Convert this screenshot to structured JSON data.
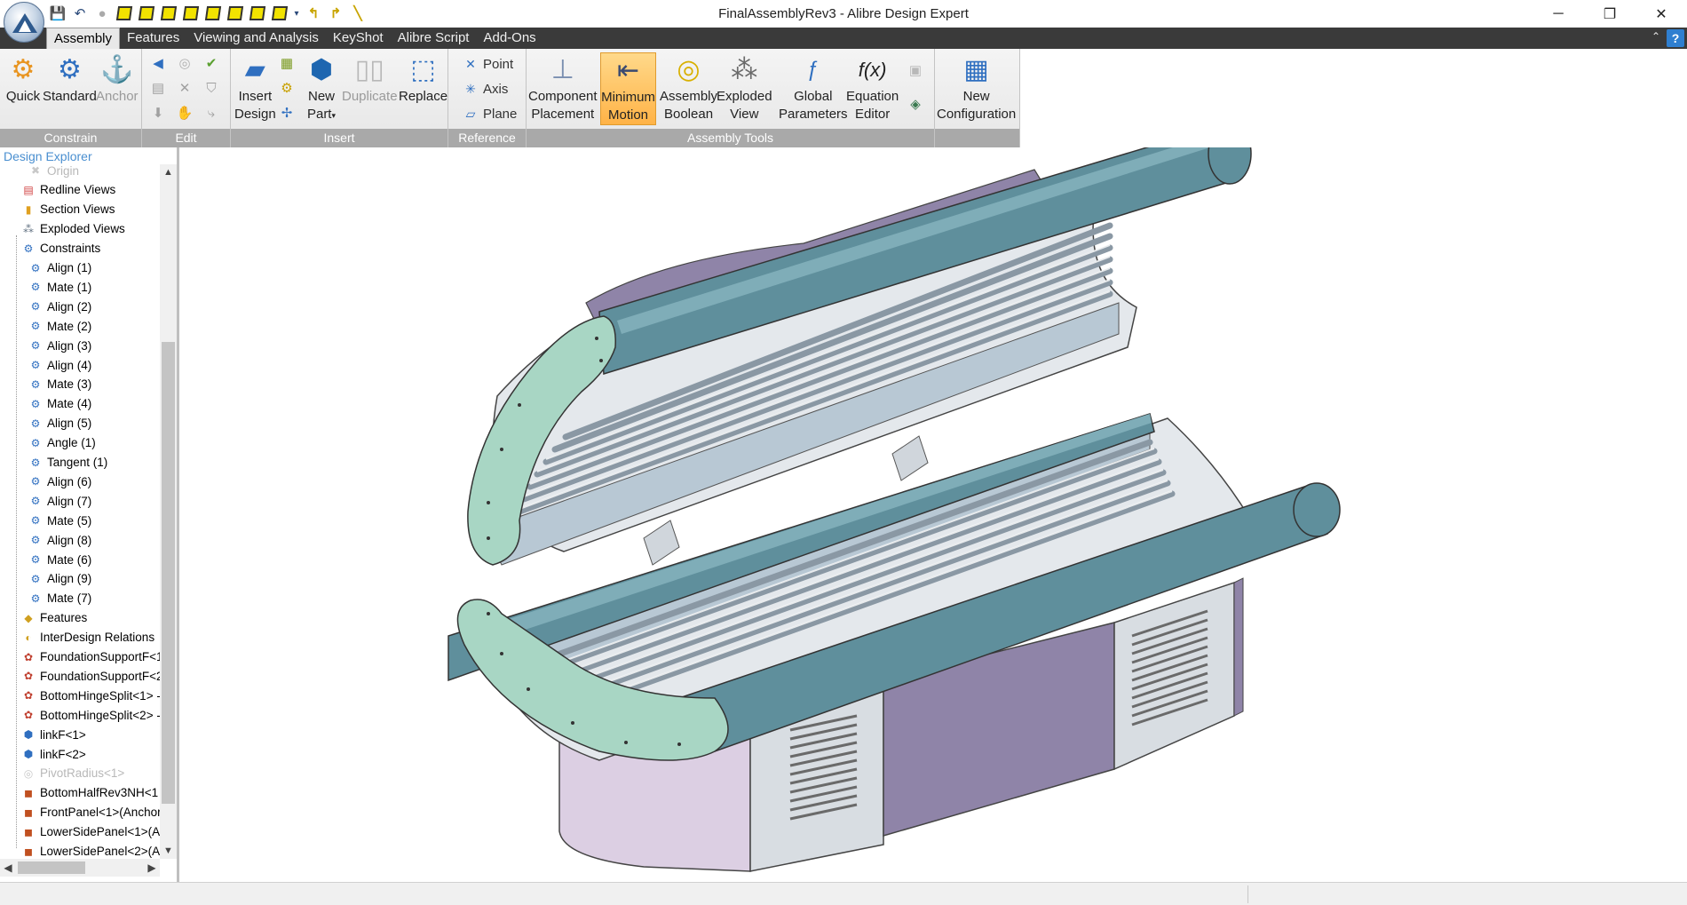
{
  "window": {
    "title": "FinalAssemblyRev3 - Alibre Design Expert",
    "controls": {
      "minimize": "─",
      "restore": "❐",
      "close": "✕"
    }
  },
  "quick_access": {
    "icons": [
      "save-icon",
      "undo-icon",
      "redo-icon",
      "box-view-icon",
      "front-view-icon",
      "back-view-icon",
      "left-view-icon",
      "right-view-icon",
      "top-view-icon",
      "bottom-view-icon",
      "iso-view-icon",
      "dropdown-icon",
      "rotate-left-icon",
      "rotate-right-icon",
      "sketch-line-icon"
    ]
  },
  "menu": {
    "tabs": [
      {
        "label": "Assembly",
        "active": true
      },
      {
        "label": "Features",
        "active": false
      },
      {
        "label": "Viewing and Analysis",
        "active": false
      },
      {
        "label": "KeyShot",
        "active": false
      },
      {
        "label": "Alibre Script",
        "active": false
      },
      {
        "label": "Add-Ons",
        "active": false
      }
    ],
    "collapse_glyph": "⌃",
    "help_glyph": "?"
  },
  "ribbon": {
    "constrain": {
      "label": "Constrain",
      "buttons": [
        {
          "label": "Quick",
          "icon": "quick-constraint-icon",
          "disabled": false
        },
        {
          "label": "Standard",
          "icon": "standard-constraint-icon",
          "disabled": false
        },
        {
          "label": "Anchor",
          "icon": "anchor-icon",
          "disabled": true
        }
      ]
    },
    "edit": {
      "label": "Edit"
    },
    "insert": {
      "label": "Insert",
      "buttons": [
        {
          "label1": "Insert",
          "label2": "Design",
          "icon": "insert-design-icon"
        },
        {
          "label1": "New",
          "label2": "Part",
          "icon": "new-part-icon"
        },
        {
          "label1": "Duplicate",
          "label2": "",
          "icon": "duplicate-icon",
          "disabled": true
        },
        {
          "label1": "Replace",
          "label2": "",
          "icon": "replace-icon"
        }
      ]
    },
    "reference": {
      "label": "Reference",
      "buttons": [
        {
          "label": "Point",
          "icon": "point-icon"
        },
        {
          "label": "Axis",
          "icon": "axis-icon"
        },
        {
          "label": "Plane",
          "icon": "plane-icon"
        }
      ]
    },
    "assembly_tools": {
      "label": "Assembly Tools",
      "buttons": [
        {
          "label1": "Component",
          "label2": "Placement",
          "icon": "component-placement-icon"
        },
        {
          "label1": "Minimum",
          "label2": "Motion",
          "icon": "minimum-motion-icon",
          "highlighted": true
        },
        {
          "label1": "Assembly",
          "label2": "Boolean",
          "icon": "assembly-boolean-icon"
        },
        {
          "label1": "Exploded",
          "label2": "View",
          "icon": "exploded-view-icon"
        },
        {
          "label1": "Global",
          "label2": "Parameters",
          "icon": "global-parameters-icon"
        },
        {
          "label1": "Equation",
          "label2": "Editor",
          "icon": "equation-editor-icon"
        }
      ]
    },
    "configuration": {
      "label1": "New",
      "label2": "Configuration",
      "icon": "new-configuration-icon"
    }
  },
  "explorer": {
    "title": "Design Explorer",
    "items": [
      {
        "label": "Origin",
        "icon": "origin-icon",
        "dim": true,
        "indent": 2
      },
      {
        "label": "Redline Views",
        "icon": "redline-views-icon",
        "indent": 1
      },
      {
        "label": "Section Views",
        "icon": "section-views-icon",
        "indent": 1
      },
      {
        "label": "Exploded Views",
        "icon": "exploded-views-icon",
        "indent": 1
      },
      {
        "label": "Constraints",
        "icon": "constraints-icon",
        "indent": 1
      },
      {
        "label": "Align (1)",
        "icon": "constraint-icon",
        "indent": 2
      },
      {
        "label": "Mate (1)",
        "icon": "constraint-icon",
        "indent": 2
      },
      {
        "label": "Align (2)",
        "icon": "constraint-icon",
        "indent": 2
      },
      {
        "label": "Mate (2)",
        "icon": "constraint-icon",
        "indent": 2
      },
      {
        "label": "Align (3)",
        "icon": "constraint-icon",
        "indent": 2
      },
      {
        "label": "Align (4)",
        "icon": "constraint-icon",
        "indent": 2
      },
      {
        "label": "Mate (3)",
        "icon": "constraint-icon",
        "indent": 2
      },
      {
        "label": "Mate (4)",
        "icon": "constraint-icon",
        "indent": 2
      },
      {
        "label": "Align (5)",
        "icon": "constraint-icon",
        "indent": 2
      },
      {
        "label": "Angle (1)",
        "icon": "constraint-icon",
        "indent": 2
      },
      {
        "label": "Tangent (1)",
        "icon": "constraint-icon",
        "indent": 2
      },
      {
        "label": "Align (6)",
        "icon": "constraint-icon",
        "indent": 2
      },
      {
        "label": "Align (7)",
        "icon": "constraint-icon",
        "indent": 2
      },
      {
        "label": "Mate (5)",
        "icon": "constraint-icon",
        "indent": 2
      },
      {
        "label": "Align (8)",
        "icon": "constraint-icon",
        "indent": 2
      },
      {
        "label": "Mate (6)",
        "icon": "constraint-icon",
        "indent": 2
      },
      {
        "label": "Align (9)",
        "icon": "constraint-icon",
        "indent": 2
      },
      {
        "label": "Mate (7)",
        "icon": "constraint-icon",
        "indent": 2
      },
      {
        "label": "Features",
        "icon": "features-icon",
        "indent": 1
      },
      {
        "label": "InterDesign Relations",
        "icon": "interdesign-icon",
        "indent": 1
      },
      {
        "label": "FoundationSupportF<1",
        "icon": "sheetmetal-part-icon",
        "indent": 1
      },
      {
        "label": "FoundationSupportF<2",
        "icon": "sheetmetal-part-icon",
        "indent": 1
      },
      {
        "label": "BottomHingeSplit<1> -",
        "icon": "sheetmetal-part-icon",
        "indent": 1
      },
      {
        "label": "BottomHingeSplit<2> -",
        "icon": "sheetmetal-part-icon",
        "indent": 1
      },
      {
        "label": "linkF<1>",
        "icon": "link-part-icon",
        "indent": 1
      },
      {
        "label": "linkF<2>",
        "icon": "link-part-icon",
        "indent": 1
      },
      {
        "label": "PivotRadius<1>",
        "icon": "suppressed-part-icon",
        "dim": true,
        "indent": 1
      },
      {
        "label": "BottomHalfRev3NH<1",
        "icon": "part-icon",
        "indent": 1
      },
      {
        "label": "FrontPanel<1>(Anchor",
        "icon": "part-icon",
        "indent": 1
      },
      {
        "label": "LowerSidePanel<1>(A",
        "icon": "part-icon",
        "indent": 1
      },
      {
        "label": "LowerSidePanel<2>(A",
        "icon": "part-icon",
        "indent": 1
      }
    ],
    "scroll": {
      "up": "▲",
      "down": "▼",
      "left": "◀",
      "right": "▶"
    }
  },
  "colors": {
    "menubar": "#3a3a3a",
    "ribbon_group_label": "#a9a9a9",
    "explorer_title": "#4a8fd0",
    "model_teal": "#5f8f9c",
    "model_mint": "#a8d6c4",
    "model_purple": "#8f84a8",
    "model_silver": "#d8dde2"
  }
}
